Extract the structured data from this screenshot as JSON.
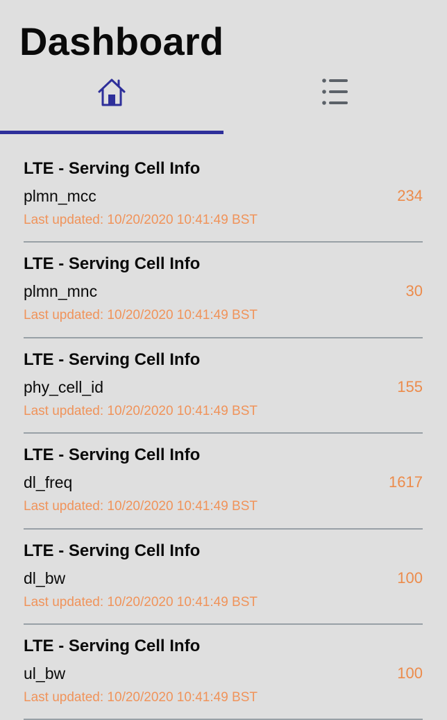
{
  "header": {
    "title": "Dashboard"
  },
  "tabs": [
    {
      "name": "home",
      "icon": "home-icon",
      "selected": true,
      "color": "#2e2f9a"
    },
    {
      "name": "list",
      "icon": "list-icon",
      "selected": false,
      "color": "#5b6168"
    }
  ],
  "colors": {
    "accent": "#2e2f9a",
    "value": "#ec8b4b",
    "timestamp": "#f0935a",
    "background": "#dfdfdf",
    "divider": "#98a0a6"
  },
  "items": [
    {
      "title": "LTE - Serving Cell Info",
      "field": "plmn_mcc",
      "value": "234",
      "updated": "Last updated: 10/20/2020 10:41:49 BST"
    },
    {
      "title": "LTE - Serving Cell Info",
      "field": "plmn_mnc",
      "value": "30",
      "updated": "Last updated: 10/20/2020 10:41:49 BST"
    },
    {
      "title": "LTE - Serving Cell Info",
      "field": "phy_cell_id",
      "value": "155",
      "updated": "Last updated: 10/20/2020 10:41:49 BST"
    },
    {
      "title": "LTE - Serving Cell Info",
      "field": "dl_freq",
      "value": "1617",
      "updated": "Last updated: 10/20/2020 10:41:49 BST"
    },
    {
      "title": "LTE - Serving Cell Info",
      "field": "dl_bw",
      "value": "100",
      "updated": "Last updated: 10/20/2020 10:41:49 BST"
    },
    {
      "title": "LTE - Serving Cell Info",
      "field": "ul_bw",
      "value": "100",
      "updated": "Last updated: 10/20/2020 10:41:49 BST"
    }
  ]
}
